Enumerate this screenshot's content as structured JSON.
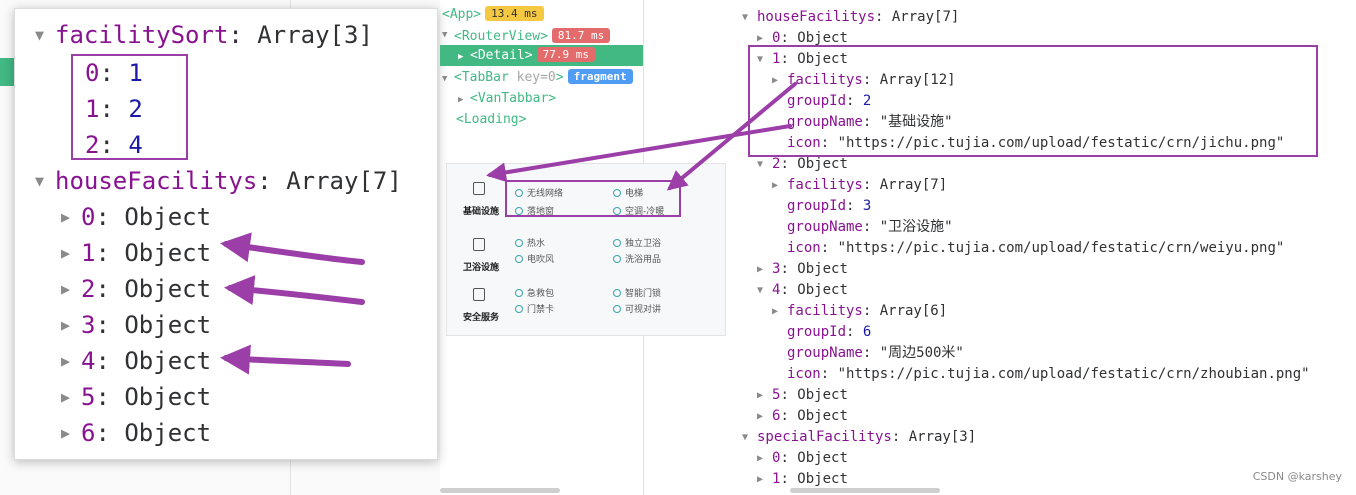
{
  "zoom": {
    "facility_sort": {
      "key": "facilitySort",
      "type": "Array[3]",
      "items": [
        {
          "index": "0",
          "value": "1"
        },
        {
          "index": "1",
          "value": "2"
        },
        {
          "index": "2",
          "value": "4"
        }
      ]
    },
    "house_facilitys": {
      "key": "houseFacilitys",
      "type": "Array[7]",
      "items": [
        {
          "index": "0",
          "type": "Object"
        },
        {
          "index": "1",
          "type": "Object"
        },
        {
          "index": "2",
          "type": "Object"
        },
        {
          "index": "3",
          "type": "Object"
        },
        {
          "index": "4",
          "type": "Object"
        },
        {
          "index": "5",
          "type": "Object"
        },
        {
          "index": "6",
          "type": "Object"
        }
      ]
    }
  },
  "component_tree": {
    "app": {
      "tag": "<App>",
      "time": "13.4 ms"
    },
    "router_view": {
      "tag": "<RouterView>",
      "time": "81.7 ms"
    },
    "detail": {
      "tag": "<Detail>",
      "time": "77.9 ms"
    },
    "tabbar": {
      "tag": "<TabBar",
      "attr": "key=0",
      "close": ">",
      "badge": "fragment"
    },
    "van_tabbar": {
      "tag": "<VanTabbar>"
    },
    "loading": {
      "tag": "<Loading>"
    }
  },
  "facility_card": {
    "groups": [
      {
        "name": "基础设施",
        "icon": "building-icon",
        "items": [
          "无线网络",
          "电梯",
          "落地窗",
          "空调-冷暖"
        ]
      },
      {
        "name": "卫浴设施",
        "icon": "bath-icon",
        "items": [
          "热水",
          "独立卫浴",
          "电吹风",
          "洗浴用品"
        ]
      },
      {
        "name": "安全服务",
        "icon": "phone-icon",
        "items": [
          "急救包",
          "智能门锁",
          "门禁卡",
          "可视对讲"
        ]
      }
    ]
  },
  "inspector": {
    "house_facilitys": {
      "key": "houseFacilitys",
      "type": "Array[7]"
    },
    "item0": {
      "index": "0",
      "type": "Object"
    },
    "item1": {
      "index": "1",
      "type": "Object",
      "facilitys_type": "Array[12]",
      "group_id": "2",
      "group_name": "\"基础设施\"",
      "icon": "\"https://pic.tujia.com/upload/festatic/crn/jichu.png\""
    },
    "item2": {
      "index": "2",
      "type": "Object",
      "facilitys_type": "Array[7]",
      "group_id": "3",
      "group_name": "\"卫浴设施\"",
      "icon": "\"https://pic.tujia.com/upload/festatic/crn/weiyu.png\""
    },
    "item3": {
      "index": "3",
      "type": "Object"
    },
    "item4": {
      "index": "4",
      "type": "Object",
      "facilitys_type": "Array[6]",
      "group_id": "6",
      "group_name": "\"周边500米\"",
      "icon": "\"https://pic.tujia.com/upload/festatic/crn/zhoubian.png\""
    },
    "item5": {
      "index": "5",
      "type": "Object"
    },
    "item6": {
      "index": "6",
      "type": "Object"
    },
    "special_facilitys": {
      "key": "specialFacilitys",
      "type": "Array[3]"
    },
    "sp0": {
      "index": "0",
      "type": "Object"
    },
    "sp1": {
      "index": "1",
      "type": "Object"
    },
    "labels": {
      "facilitys": "facilitys",
      "group_id": "groupId",
      "group_name": "groupName",
      "icon": "icon"
    }
  },
  "watermark": "CSDN @karshey",
  "colors": {
    "accent_purple": "#9b3ea7",
    "vue_green": "#42b883",
    "key_purple": "#881391",
    "number_blue": "#1a1aa6",
    "string_red": "#c41a16"
  }
}
